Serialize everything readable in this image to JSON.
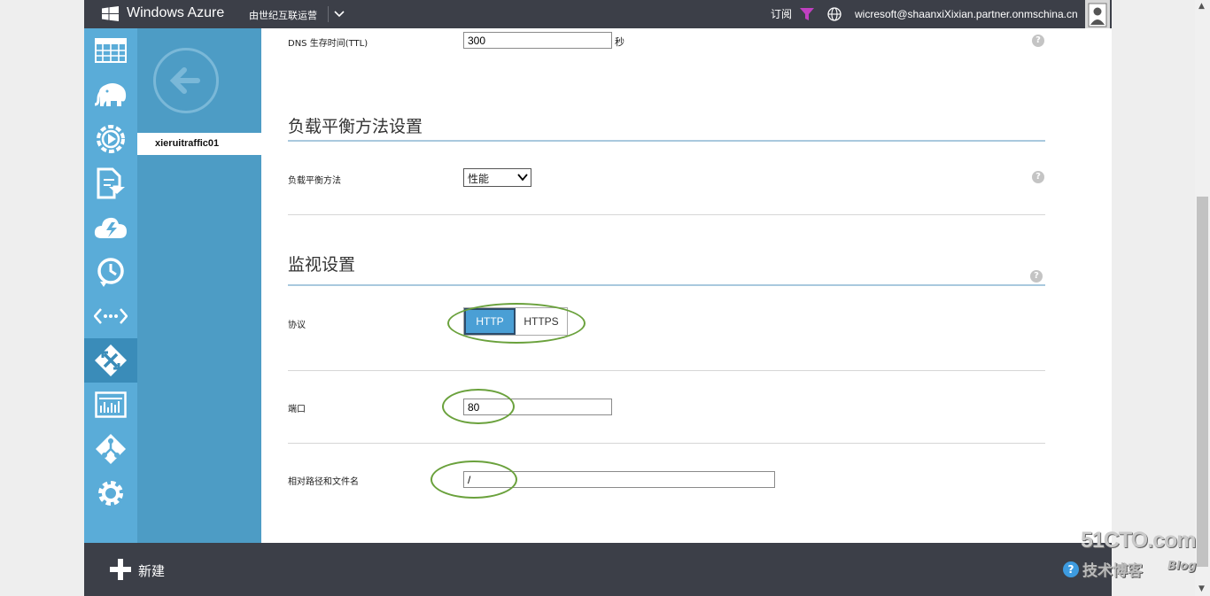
{
  "header": {
    "brand": "Windows Azure",
    "operator": "由世纪互联运营",
    "subscriptions_label": "订阅",
    "user_email": "wicresoft@shaanxiXixian.partner.onmschina.cn"
  },
  "nav": {
    "items": [
      {
        "name": "all-items",
        "icon": "grid-icon"
      },
      {
        "name": "hdinsight",
        "icon": "elephant-icon"
      },
      {
        "name": "media-services",
        "icon": "play-gear-icon"
      },
      {
        "name": "storsimple",
        "icon": "import-export-icon"
      },
      {
        "name": "cloud-services",
        "icon": "cloud-icon"
      },
      {
        "name": "recovery-services",
        "icon": "clock-arrow-icon"
      },
      {
        "name": "networks",
        "icon": "code-dots-icon"
      },
      {
        "name": "traffic-manager",
        "icon": "traffic-manager-icon",
        "active": true
      },
      {
        "name": "management-services",
        "icon": "dashboard-icon"
      },
      {
        "name": "active-directory",
        "icon": "directory-icon"
      },
      {
        "name": "settings",
        "icon": "gear-icon"
      }
    ]
  },
  "subnav": {
    "selected_item": "xieruitraffic01"
  },
  "form": {
    "dns_ttl_label": "DNS 生存时间(TTL)",
    "dns_ttl_value": "300",
    "dns_ttl_unit": "秒",
    "lb_section_title": "负载平衡方法设置",
    "lb_method_label": "负载平衡方法",
    "lb_method_value": "性能",
    "monitor_section_title": "监视设置",
    "protocol_label": "协议",
    "protocol_options": [
      "HTTP",
      "HTTPS"
    ],
    "protocol_selected": "HTTP",
    "port_label": "端口",
    "port_value": "80",
    "path_label": "相对路径和文件名",
    "path_value": "/",
    "help_glyph": "?"
  },
  "footer": {
    "new_label": "新建",
    "help_glyph": "?"
  },
  "watermark": {
    "site": "51CTO.com",
    "tagline": "技术博客",
    "blog": "Blog"
  },
  "colors": {
    "topbar": "#3c3f48",
    "nav_rail": "#5aacd8",
    "nav_active": "#3a8cb9",
    "subpanel": "#4d9cc5",
    "accent": "#4a9fd5",
    "annotation": "#6aa13c"
  }
}
